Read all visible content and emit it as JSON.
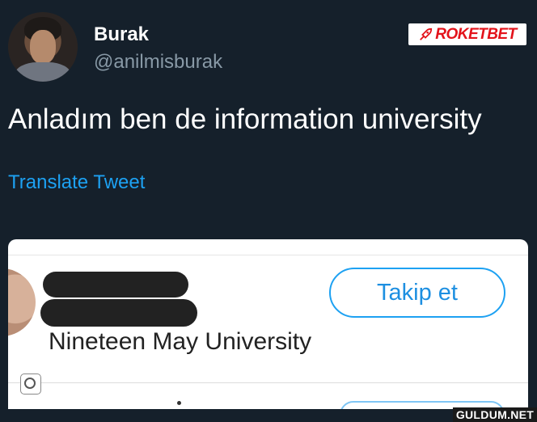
{
  "tweet": {
    "author": {
      "display_name": "Burak",
      "handle": "@anilmisburak"
    },
    "text": "Anladım ben de information university",
    "translate_label": "Translate Tweet"
  },
  "brand": {
    "logo_text": "ROKETBET",
    "color": "#e3131b"
  },
  "embedded_card": {
    "university": "Nineteen May University",
    "follow_label": "Takip et"
  },
  "watermark": "GULDUM.NET",
  "colors": {
    "background": "#15202b",
    "link": "#1da1f2",
    "secondary_text": "#8899a6"
  }
}
